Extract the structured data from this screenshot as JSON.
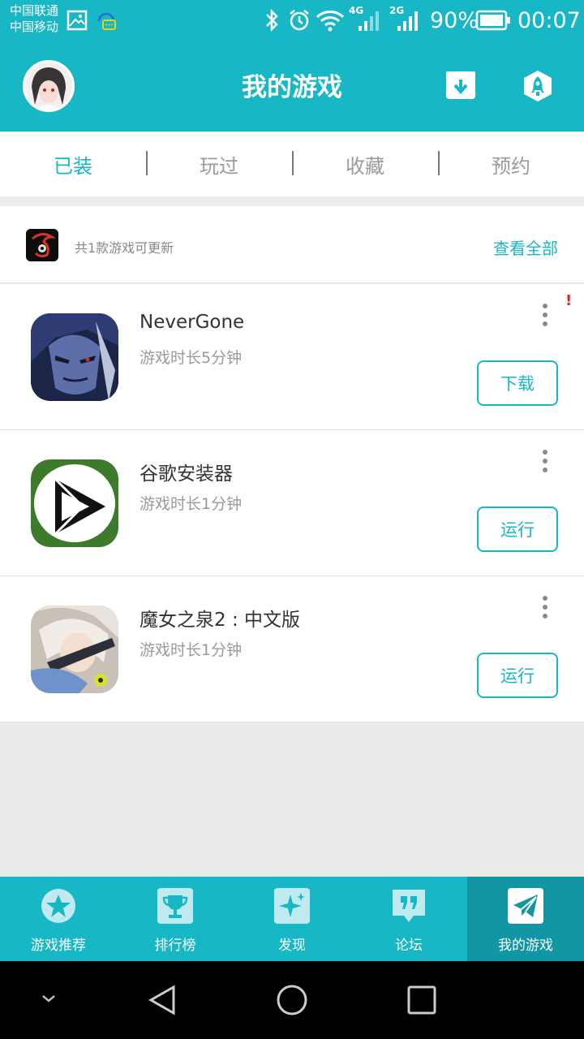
{
  "status_bar": {
    "carrier_1": "中国联通",
    "carrier_2": "中国移动",
    "network_1": "4G",
    "network_2": "2G",
    "battery": "90%",
    "time": "00:07"
  },
  "header": {
    "title": "我的游戏",
    "download_manager_icon": "download-box-icon",
    "speedup_icon": "rocket-icon"
  },
  "tabs": [
    {
      "label": "已装",
      "active": true
    },
    {
      "label": "玩过",
      "active": false
    },
    {
      "label": "收藏",
      "active": false
    },
    {
      "label": "预约",
      "active": false
    }
  ],
  "update_bar": {
    "text": "共1款游戏可更新",
    "view_all": "查看全部"
  },
  "games": [
    {
      "name": "NeverGone",
      "playtime": "游戏时长5分钟",
      "button": "下载",
      "alert": "!"
    },
    {
      "name": "谷歌安装器",
      "playtime": "游戏时长1分钟",
      "button": "运行"
    },
    {
      "name": "魔女之泉2 : 中文版",
      "playtime": "游戏时长1分钟",
      "button": "运行"
    }
  ],
  "bottom_nav": [
    {
      "label": "游戏推荐",
      "icon": "star-icon",
      "active": false
    },
    {
      "label": "排行榜",
      "icon": "trophy-icon",
      "active": false
    },
    {
      "label": "发现",
      "icon": "sparkle-icon",
      "active": false
    },
    {
      "label": "论坛",
      "icon": "quote-icon",
      "active": false
    },
    {
      "label": "我的游戏",
      "icon": "paper-plane-icon",
      "active": true
    }
  ],
  "colors": {
    "accent": "#17b7c6",
    "accent_dark": "#1196a3",
    "background": "#ebebeb",
    "alert": "#e0231b"
  }
}
